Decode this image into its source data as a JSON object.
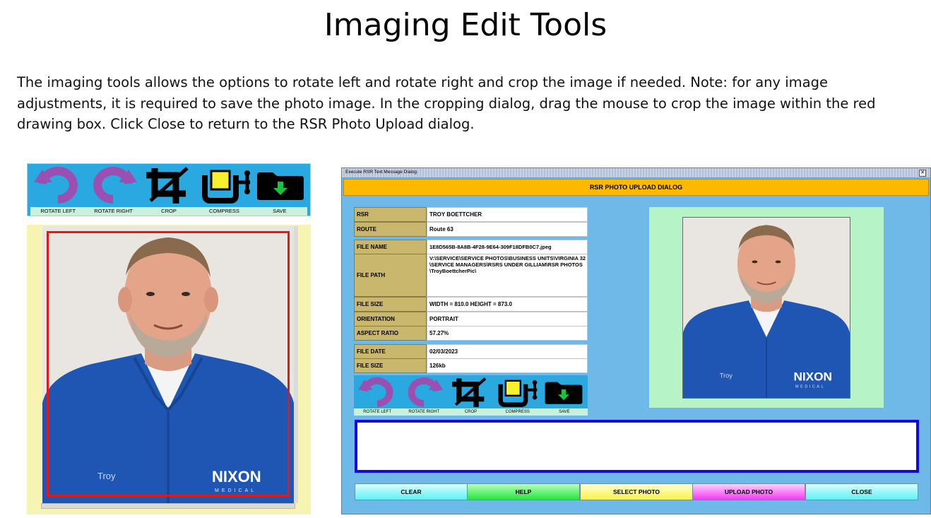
{
  "slide": {
    "title": "Imaging Edit Tools",
    "description": "The imaging tools allows the options to rotate left and rotate right and crop the image if needed. Note: for any image adjustments, it is required to save the photo image.  In the cropping dialog, drag the mouse to crop the image within the red drawing box.  Click Close to return to the RSR Photo Upload dialog."
  },
  "toolbar": {
    "rotate_left": "ROTATE LEFT",
    "rotate_right": "ROTATE RIGHT",
    "crop": "CROP",
    "compress": "COMPRESS",
    "save": "SAVE"
  },
  "photo": {
    "name_tag": "Troy",
    "logo_text": "NIXON",
    "logo_sub": "MEDICAL"
  },
  "dialog": {
    "window_title": "Execute RSR Text Message Dialog",
    "close_glyph": "✕",
    "header": "RSR PHOTO UPLOAD DIALOG",
    "fields": {
      "rsr_label": "RSR",
      "rsr_value": "TROY BOETTCHER",
      "route_label": "ROUTE",
      "route_value": "Route 63",
      "file_name_label": "FILE NAME",
      "file_name_value": "1E8D565B-8A8B-4F28-9E64-309F18DFB0C7.jpeg",
      "file_path_label": "FILE PATH",
      "file_path_value": "V:\\SERVICE\\SERVICE PHOTOS\\BUSINESS UNITS\\VIRGINIA 32\\SERVICE MANAGERS\\RSRS UNDER GILLIAM\\RSR PHOTOS\\TroyBoettcherPic\\",
      "file_size_label": "FILE SIZE",
      "file_size_value": "WIDTH = 810.0  HEIGHT = 873.0",
      "orientation_label": "ORIENTATION",
      "orientation_value": "PORTRAIT",
      "aspect_label": "ASPECT RATIO",
      "aspect_value": "57.27%",
      "file_date_label": "FILE DATE",
      "file_date_value": "02/03/2023",
      "file_size2_label": "FILE SIZE",
      "file_size2_value": "126kb"
    },
    "buttons": {
      "clear": "CLEAR",
      "help": "HELP",
      "select_photo": "SELECT PHOTO",
      "upload_photo": "UPLOAD PHOTO",
      "close": "CLOSE"
    }
  },
  "colors": {
    "toolbar_bg": "#2aa8e0",
    "icon_purple": "#9b4fb0",
    "crop_border": "#e01a1a",
    "dialog_bg": "#6eb9e8",
    "header_yellow": "#fdb900",
    "message_border": "#0b0bdb"
  }
}
